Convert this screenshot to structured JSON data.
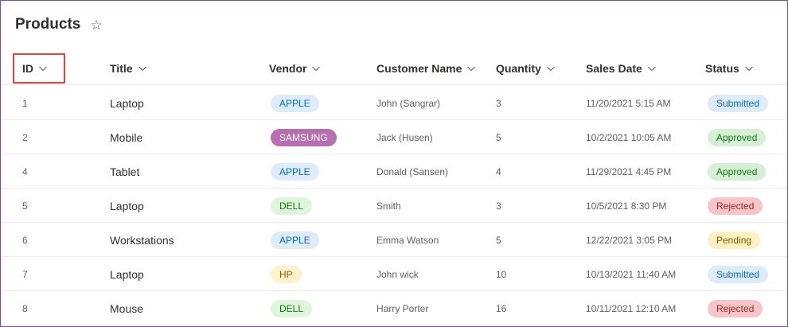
{
  "page": {
    "title": "Products"
  },
  "columns": {
    "id": "ID",
    "title": "Title",
    "vendor": "Vendor",
    "customer": "Customer Name",
    "quantity": "Quantity",
    "sales_date": "Sales Date",
    "status": "Status"
  },
  "rows": [
    {
      "id": "1",
      "title": "Laptop",
      "vendor": "APPLE",
      "customer": "John (Sangrar)",
      "quantity": "3",
      "sales_date": "11/20/2021 5:15 AM",
      "status": "Submitted"
    },
    {
      "id": "2",
      "title": "Mobile",
      "vendor": "SAMSUNG",
      "customer": "Jack (Husen)",
      "quantity": "5",
      "sales_date": "10/2/2021 10:05 AM",
      "status": "Approved"
    },
    {
      "id": "4",
      "title": "Tablet",
      "vendor": "APPLE",
      "customer": "Donald (Sansen)",
      "quantity": "4",
      "sales_date": "11/29/2021 4:45 PM",
      "status": "Approved"
    },
    {
      "id": "5",
      "title": "Laptop",
      "vendor": "DELL",
      "customer": "Smith",
      "quantity": "3",
      "sales_date": "10/5/2021 8:30 PM",
      "status": "Rejected"
    },
    {
      "id": "6",
      "title": "Workstations",
      "vendor": "APPLE",
      "customer": "Emma Watson",
      "quantity": "5",
      "sales_date": "12/22/2021 3:05 PM",
      "status": "Pending"
    },
    {
      "id": "7",
      "title": "Laptop",
      "vendor": "HP",
      "customer": "John wick",
      "quantity": "10",
      "sales_date": "10/13/2021 11:40 AM",
      "status": "Submitted"
    },
    {
      "id": "8",
      "title": "Mouse",
      "vendor": "DELL",
      "customer": "Harry Porter",
      "quantity": "16",
      "sales_date": "10/11/2021 12:10 AM",
      "status": "Rejected"
    }
  ],
  "vendor_colors": {
    "APPLE": {
      "bg": "#deecf9",
      "fg": "#0f6cbd"
    },
    "SAMSUNG": {
      "bg": "#b86fb0",
      "fg": "#ffffff"
    },
    "DELL": {
      "bg": "#dff6dd",
      "fg": "#107c10"
    },
    "HP": {
      "bg": "#fff1ce",
      "fg": "#8a6100"
    }
  },
  "status_colors": {
    "Submitted": {
      "bg": "#deecf9",
      "fg": "#0f6cbd"
    },
    "Approved": {
      "bg": "#d5f0d4",
      "fg": "#107c10"
    },
    "Rejected": {
      "bg": "#f7c5c8",
      "fg": "#a4262c"
    },
    "Pending": {
      "bg": "#fff1c2",
      "fg": "#7a5a00"
    }
  },
  "icons": {
    "favorite": "star-outline-icon",
    "sort": "chevron-down-icon"
  }
}
